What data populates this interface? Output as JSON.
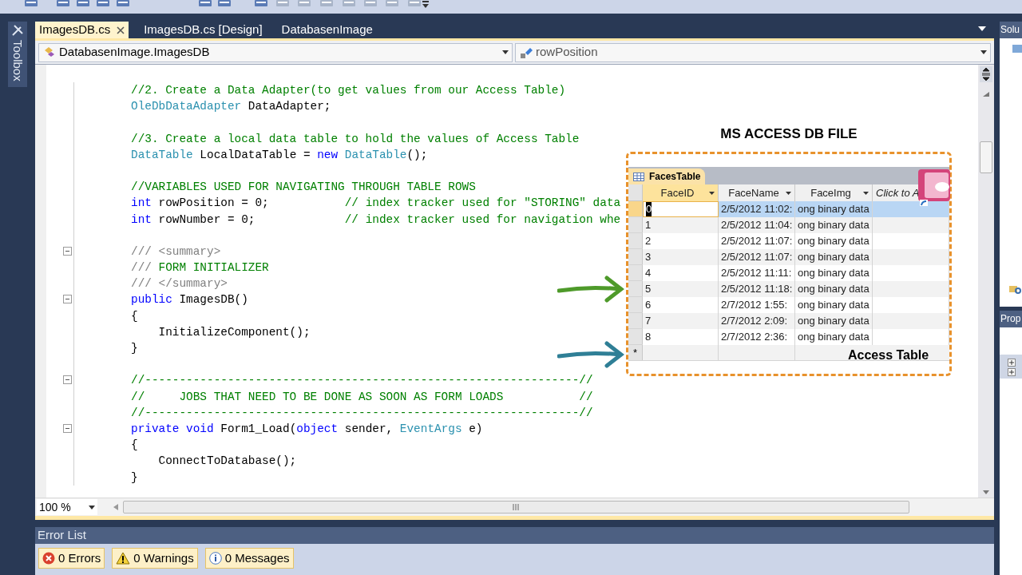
{
  "toolbox_tab": {
    "label": "Toolbox"
  },
  "document_tabs": [
    {
      "label": "ImagesDB.cs",
      "selected": true
    },
    {
      "label": "ImagesDB.cs [Design]",
      "selected": false
    },
    {
      "label": "DatabasenImage",
      "selected": false
    }
  ],
  "navigation_bar": {
    "type_dropdown": "DatabasenImage.ImagesDB",
    "member_dropdown": "rowPosition"
  },
  "code_lines": [
    {
      "collapsible": false,
      "tokens": [
        {
          "kind": "comment",
          "text": "//2. Create a Data Adapter(to get values from our Access Table)"
        }
      ]
    },
    {
      "collapsible": false,
      "tokens": [
        {
          "kind": "type",
          "text": "OleDbDataAdapter"
        },
        {
          "kind": "plain",
          "text": " DataAdapter;"
        }
      ]
    },
    {
      "collapsible": false
    },
    {
      "collapsible": false,
      "tokens": [
        {
          "kind": "comment",
          "text": "//3. Create a local data table to hold the values of Access Table"
        }
      ]
    },
    {
      "collapsible": false,
      "tokens": [
        {
          "kind": "type",
          "text": "DataTable"
        },
        {
          "kind": "plain",
          "text": " LocalDataTable = "
        },
        {
          "kind": "keyword",
          "text": "new"
        },
        {
          "kind": "type",
          "text": " DataTable"
        },
        {
          "kind": "plain",
          "text": "();"
        }
      ]
    },
    {
      "collapsible": false
    },
    {
      "collapsible": false,
      "tokens": [
        {
          "kind": "comment",
          "text": "//VARIABLES USED FOR NAVIGATING THROUGH TABLE ROWS"
        }
      ]
    },
    {
      "collapsible": false,
      "tokens": [
        {
          "kind": "keyword",
          "text": "int"
        },
        {
          "kind": "plain",
          "text": " rowPosition = 0;           "
        },
        {
          "kind": "comment",
          "text": "// index tracker used for \"STORING\" data"
        }
      ]
    },
    {
      "collapsible": false,
      "tokens": [
        {
          "kind": "keyword",
          "text": "int"
        },
        {
          "kind": "plain",
          "text": " rowNumber = 0;             "
        },
        {
          "kind": "comment",
          "text": "// index tracker used for navigation whe"
        }
      ]
    },
    {
      "collapsible": false
    },
    {
      "collapsible": true,
      "tokens": [
        {
          "kind": "xmldoc",
          "text": "/// <summary>"
        }
      ]
    },
    {
      "collapsible": false,
      "tokens": [
        {
          "kind": "xmldoc",
          "text": "///"
        },
        {
          "kind": "comment",
          "text": " FORM INITIALIZER"
        }
      ]
    },
    {
      "collapsible": false,
      "tokens": [
        {
          "kind": "xmldoc",
          "text": "/// </summary>"
        }
      ]
    },
    {
      "collapsible": true,
      "tokens": [
        {
          "kind": "keyword",
          "text": "public"
        },
        {
          "kind": "plain",
          "text": " ImagesDB()"
        }
      ]
    },
    {
      "collapsible": false,
      "tokens": [
        {
          "kind": "plain",
          "text": "{"
        }
      ]
    },
    {
      "collapsible": false,
      "tokens": [
        {
          "kind": "plain",
          "text": "    InitializeComponent();"
        }
      ]
    },
    {
      "collapsible": false,
      "tokens": [
        {
          "kind": "plain",
          "text": "}"
        }
      ]
    },
    {
      "collapsible": false
    },
    {
      "collapsible": true,
      "tokens": [
        {
          "kind": "comment",
          "text": "//---------------------------------------------------------------//"
        }
      ]
    },
    {
      "collapsible": false,
      "tokens": [
        {
          "kind": "comment",
          "text": "//     JOBS THAT NEED TO BE DONE AS SOON AS FORM LOADS           //"
        }
      ]
    },
    {
      "collapsible": false,
      "tokens": [
        {
          "kind": "comment",
          "text": "//---------------------------------------------------------------//"
        }
      ]
    },
    {
      "collapsible": true,
      "tokens": [
        {
          "kind": "keyword",
          "text": "private void"
        },
        {
          "kind": "plain",
          "text": " Form1_Load("
        },
        {
          "kind": "keyword",
          "text": "object"
        },
        {
          "kind": "plain",
          "text": " sender, "
        },
        {
          "kind": "type",
          "text": "EventArgs"
        },
        {
          "kind": "plain",
          "text": " e)"
        }
      ]
    },
    {
      "collapsible": false,
      "tokens": [
        {
          "kind": "plain",
          "text": "{"
        }
      ]
    },
    {
      "collapsible": false,
      "tokens": [
        {
          "kind": "plain",
          "text": "    ConnectToDatabase();"
        }
      ]
    },
    {
      "collapsible": false,
      "tokens": [
        {
          "kind": "plain",
          "text": "}"
        }
      ]
    }
  ],
  "zoom": "100 %",
  "error_list": {
    "title": "Error List",
    "filters": [
      {
        "kind": "error",
        "label": "0 Errors",
        "on": true
      },
      {
        "kind": "warning",
        "label": "0 Warnings",
        "on": true
      },
      {
        "kind": "message",
        "label": "0 Messages",
        "on": true
      }
    ]
  },
  "side_panels": [
    {
      "title": "Solu"
    },
    {
      "title": "Prop"
    }
  ],
  "overlay": {
    "title": "MS ACCESS DB FILE",
    "caption": "Access Table",
    "table": {
      "tab": "FacesTable",
      "columns": [
        {
          "label": "FaceID",
          "kind": "field",
          "selected": true
        },
        {
          "label": "FaceName",
          "kind": "field",
          "selected": false
        },
        {
          "label": "FaceImg",
          "kind": "field",
          "selected": false
        },
        {
          "label": "Click to A",
          "kind": "add",
          "selected": false
        }
      ],
      "rows": [
        {
          "selected": true,
          "cells": [
            "0",
            "2/5/2012 11:02:",
            "ong binary data"
          ]
        },
        {
          "selected": false,
          "cells": [
            "1",
            "2/5/2012 11:04:",
            "ong binary data"
          ]
        },
        {
          "selected": false,
          "cells": [
            "2",
            "2/5/2012 11:07:",
            "ong binary data"
          ]
        },
        {
          "selected": false,
          "cells": [
            "3",
            "2/5/2012 11:07:",
            "ong binary data"
          ]
        },
        {
          "selected": false,
          "cells": [
            "4",
            "2/5/2012 11:11:",
            "ong binary data"
          ]
        },
        {
          "selected": false,
          "cells": [
            "5",
            "2/5/2012 11:18:",
            "ong binary data"
          ]
        },
        {
          "selected": false,
          "cells": [
            "6",
            "2/7/2012 1:55:",
            "ong binary data"
          ]
        },
        {
          "selected": false,
          "cells": [
            "7",
            "2/7/2012 2:09:",
            "ong binary data"
          ]
        },
        {
          "selected": false,
          "cells": [
            "8",
            "2/7/2012 2:36:",
            "ong binary data"
          ]
        }
      ],
      "new_row_marker": "*"
    }
  }
}
